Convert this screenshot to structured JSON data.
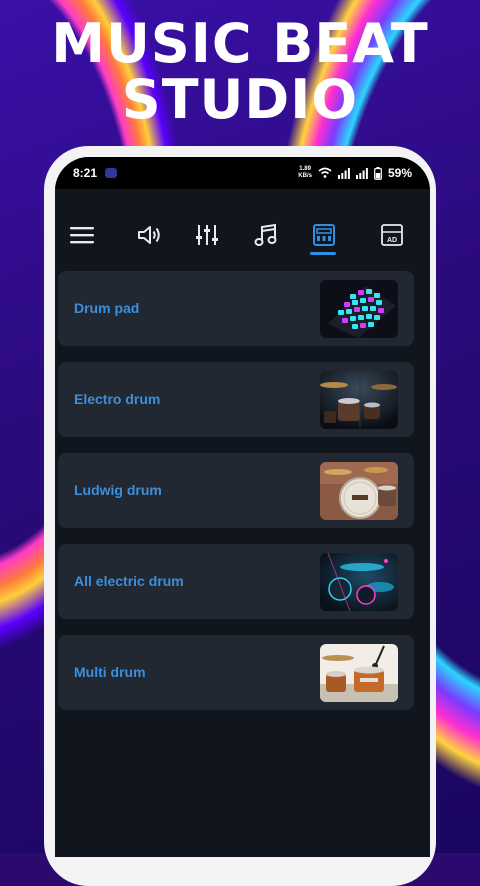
{
  "promo": {
    "title_line1": "MUSIC BEAT",
    "title_line2": "STUDIO"
  },
  "status_bar": {
    "time": "8:21",
    "net_speed_value": "1.89",
    "net_speed_unit": "KB/s",
    "battery": "59%"
  },
  "toolbar": {
    "icons": [
      "menu-icon",
      "speaker-icon",
      "equalizer-icon",
      "music-note-icon",
      "drum-kit-icon",
      "ad-icon"
    ],
    "ad_label": "AD",
    "active_index": 4
  },
  "drums": {
    "items": [
      {
        "label": "Drum pad",
        "thumbnail": "drum-pad-thumbnail"
      },
      {
        "label": "Electro drum",
        "thumbnail": "electro-drum-thumbnail"
      },
      {
        "label": "Ludwig drum",
        "thumbnail": "ludwig-drum-thumbnail"
      },
      {
        "label": "All electric drum",
        "thumbnail": "all-electric-drum-thumbnail"
      },
      {
        "label": "Multi drum",
        "thumbnail": "multi-drum-thumbnail"
      }
    ]
  },
  "colors": {
    "accent": "#2f8fe0",
    "label": "#3b8fdb",
    "card": "#222831",
    "screen": "#11161e"
  }
}
